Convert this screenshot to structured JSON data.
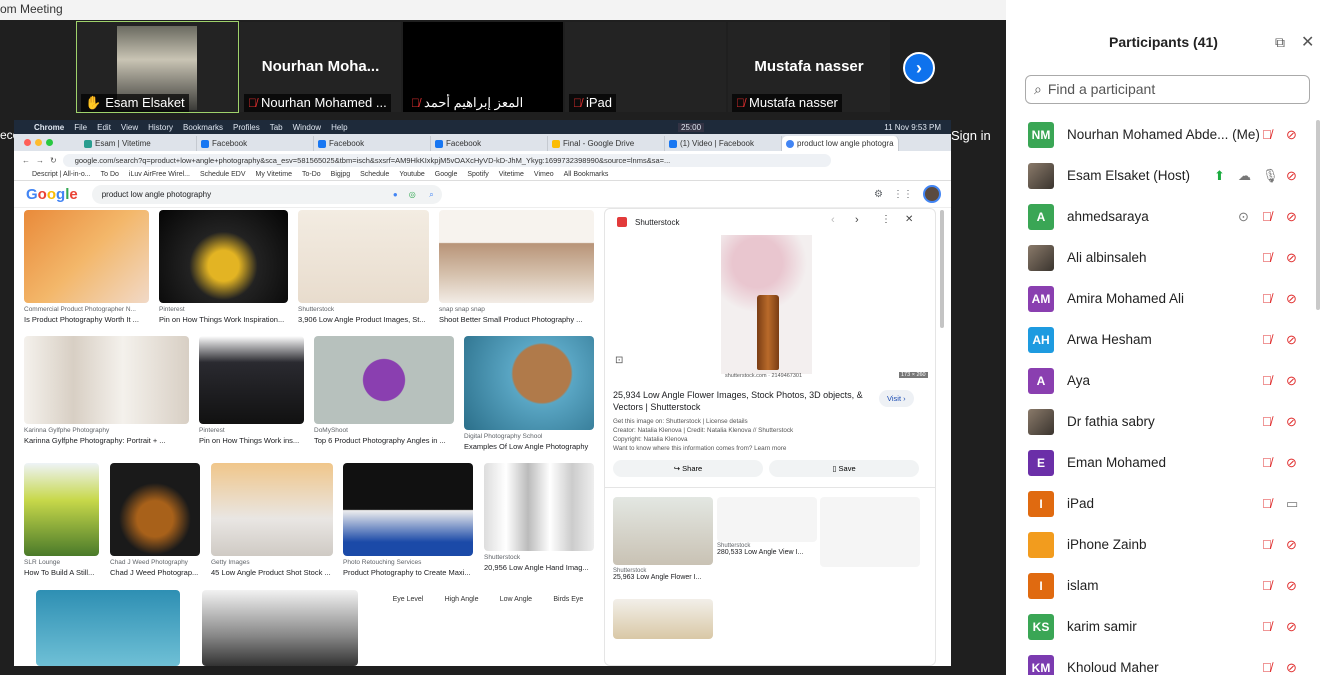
{
  "window": {
    "title": "om Meeting",
    "minimize": "—",
    "maximize": "❐",
    "close": "✕"
  },
  "tiles": [
    {
      "name": "",
      "label": "Esam Elsaket",
      "muted": false,
      "selected": true
    },
    {
      "name": "Nourhan  Moha...",
      "label": "Nourhan Mohamed ...",
      "muted": true,
      "selected": false
    },
    {
      "name": "",
      "label": "المعز إبراهيم أحمد",
      "muted": true,
      "selected": false
    },
    {
      "name": "",
      "label": "iPad",
      "muted": true,
      "selected": false
    },
    {
      "name": "Mustafa nasser",
      "label": "Mustafa nasser",
      "muted": true,
      "selected": false
    }
  ],
  "next_icon": "›",
  "recording": "ecording",
  "sign_in": "Sign in",
  "mac_menu": [
    "Chrome",
    "File",
    "Edit",
    "View",
    "History",
    "Bookmarks",
    "Profiles",
    "Tab",
    "Window",
    "Help"
  ],
  "mac_clock": "11 Nov  9:53 PM",
  "mac_timer": "25:00",
  "browser_tabs": [
    "Esam | Vitetime",
    "Facebook",
    "Facebook",
    "Facebook",
    "Final - Google Drive",
    "(1) Video | Facebook",
    "product low angle photogra"
  ],
  "url": "google.com/search?q=product+low+angle+photography&sca_esv=581565025&tbm=isch&sxsrf=AM9HkKIxkpjM5vOAXcHyVD-kD-JhM_Ykyg:1699732398990&source=lnms&sa=...",
  "bookmarks": [
    "Descript | All-in-o...",
    "To Do",
    "iLuv AirFree Wirel...",
    "Schedule EDV",
    "My Vitetime",
    "To-Do",
    "Bigjpg",
    "Schedule",
    "Youtube",
    "Google",
    "Spotify",
    "Vitetime",
    "Vimeo",
    "All Bookmarks"
  ],
  "google": {
    "logo": "Google",
    "query": "product low angle photography"
  },
  "results": [
    {
      "src": "Commercial Product Photographer N...",
      "cap": "Is Product Photography Worth It ..."
    },
    {
      "src": "Pinterest",
      "cap": "Pin on How Things Work Inspiration..."
    },
    {
      "src": "Shutterstock",
      "cap": "3,906 Low Angle Product Images, St..."
    },
    {
      "src": "snap snap snap",
      "cap": "Shoot Better Small Product Photography ..."
    },
    {
      "src": "Karinna Gylfphe Photography",
      "cap": "Karinna Gylfphe Photography: Portrait + ..."
    },
    {
      "src": "Pinterest",
      "cap": "Pin on How Things Work ins..."
    },
    {
      "src": "DoMyShoot",
      "cap": "Top 6 Product Photography Angles in ..."
    },
    {
      "src": "Digital Photography School",
      "cap": "Examples Of Low Angle Photography"
    },
    {
      "src": "SLR Lounge",
      "cap": "How To Build A Still..."
    },
    {
      "src": "Chad J Weed Photography",
      "cap": "Chad J Weed Photograp..."
    },
    {
      "src": "Getty Images",
      "cap": "45 Low Angle Product Shot Stock ..."
    },
    {
      "src": "Photo Retouching Services",
      "cap": "Product Photography to Create Maxi..."
    },
    {
      "src": "Shutterstock",
      "cap": "20,956 Low Angle Hand Imag..."
    }
  ],
  "angle_labels": [
    "Eye Level",
    "High Angle",
    "Low Angle",
    "Birds Eye"
  ],
  "panel": {
    "source": "Shutterstock",
    "img_credit": "shutterstock.com · 2149467301",
    "img_size": "173 × 260",
    "title": "25,934 Low Angle Flower Images, Stock Photos, 3D objects, & Vectors | Shutterstock",
    "visit": "Visit",
    "info1": "Get this image on: Shutterstock | License details",
    "info2": "Creator: Natalia Klenova | Credit: Natalia Klenova // Shutterstock",
    "info3": "Copyright: Natalia Klenova",
    "info4": "Want to know where this information comes from? Learn more",
    "share": "Share",
    "save": "Save",
    "related": [
      {
        "src": "Shutterstock",
        "cap": "25,963 Low Angle Flower I..."
      },
      {
        "src": "Shutterstock",
        "cap": "280,533 Low Angle View I..."
      }
    ]
  },
  "participants": {
    "title": "Participants (41)",
    "search_placeholder": "Find a participant",
    "list": [
      {
        "initials": "NM",
        "name": "Nourhan Mohamed Abde... (Me)",
        "color": "#3aa655",
        "mic": "muted",
        "video": "off"
      },
      {
        "initials": "",
        "name": "Esam Elsaket (Host)",
        "color": "",
        "mic": "on",
        "video": "off"
      },
      {
        "initials": "A",
        "name": "ahmedsaraya",
        "color": "#3aa655",
        "mic": "muted",
        "video": "off"
      },
      {
        "initials": "",
        "name": "Ali albinsaleh",
        "color": "",
        "mic": "muted",
        "video": "off"
      },
      {
        "initials": "AM",
        "name": "Amira Mohamed Ali",
        "color": "#8a3fb0",
        "mic": "muted",
        "video": "off"
      },
      {
        "initials": "AH",
        "name": "Arwa Hesham",
        "color": "#1e9be0",
        "mic": "muted",
        "video": "off"
      },
      {
        "initials": "A",
        "name": "Aya",
        "color": "#8a3fb0",
        "mic": "muted",
        "video": "off"
      },
      {
        "initials": "",
        "name": "Dr fathia sabry",
        "color": "",
        "mic": "muted",
        "video": "off"
      },
      {
        "initials": "E",
        "name": "Eman Mohamed",
        "color": "#6b2fa8",
        "mic": "muted",
        "video": "off"
      },
      {
        "initials": "I",
        "name": "iPad",
        "color": "#e06a10",
        "mic": "muted",
        "video": "on"
      },
      {
        "initials": "",
        "name": "iPhone Zainb",
        "color": "#f29c1e",
        "mic": "muted",
        "video": "off"
      },
      {
        "initials": "I",
        "name": "islam",
        "color": "#e06a10",
        "mic": "muted",
        "video": "off"
      },
      {
        "initials": "KS",
        "name": "karim samir",
        "color": "#3aa655",
        "mic": "muted",
        "video": "off"
      },
      {
        "initials": "KM",
        "name": "Kholoud Maher",
        "color": "#7b3bb0",
        "mic": "muted",
        "video": "off"
      }
    ]
  }
}
